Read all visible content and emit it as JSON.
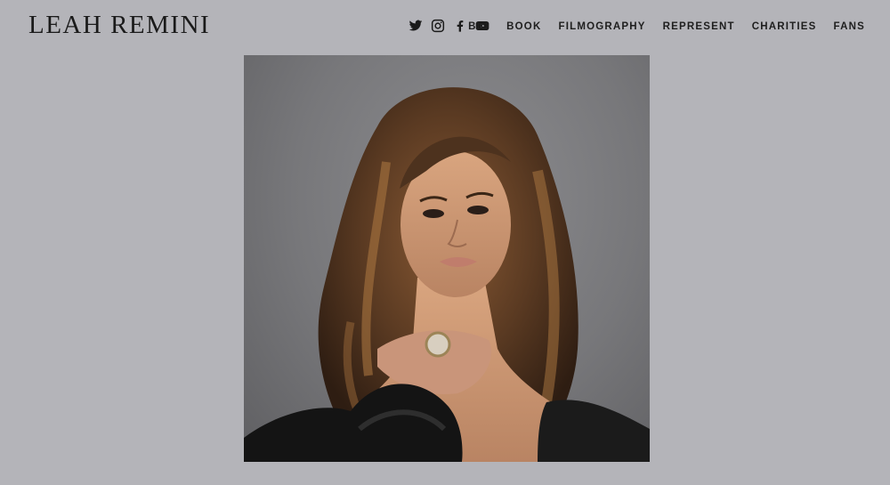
{
  "header": {
    "logo": "LEAH REMINI",
    "social": [
      {
        "icon": "twitter-icon"
      },
      {
        "icon": "instagram-icon"
      },
      {
        "icon": "facebook-icon"
      },
      {
        "icon": "youtube-icon"
      }
    ],
    "nav": [
      "BIO",
      "BOOK",
      "FILMOGRAPHY",
      "REPRESENT",
      "CHARITIES",
      "FANS"
    ]
  },
  "colors": {
    "background": "#b4b4b9",
    "text": "#1a1a1a"
  }
}
